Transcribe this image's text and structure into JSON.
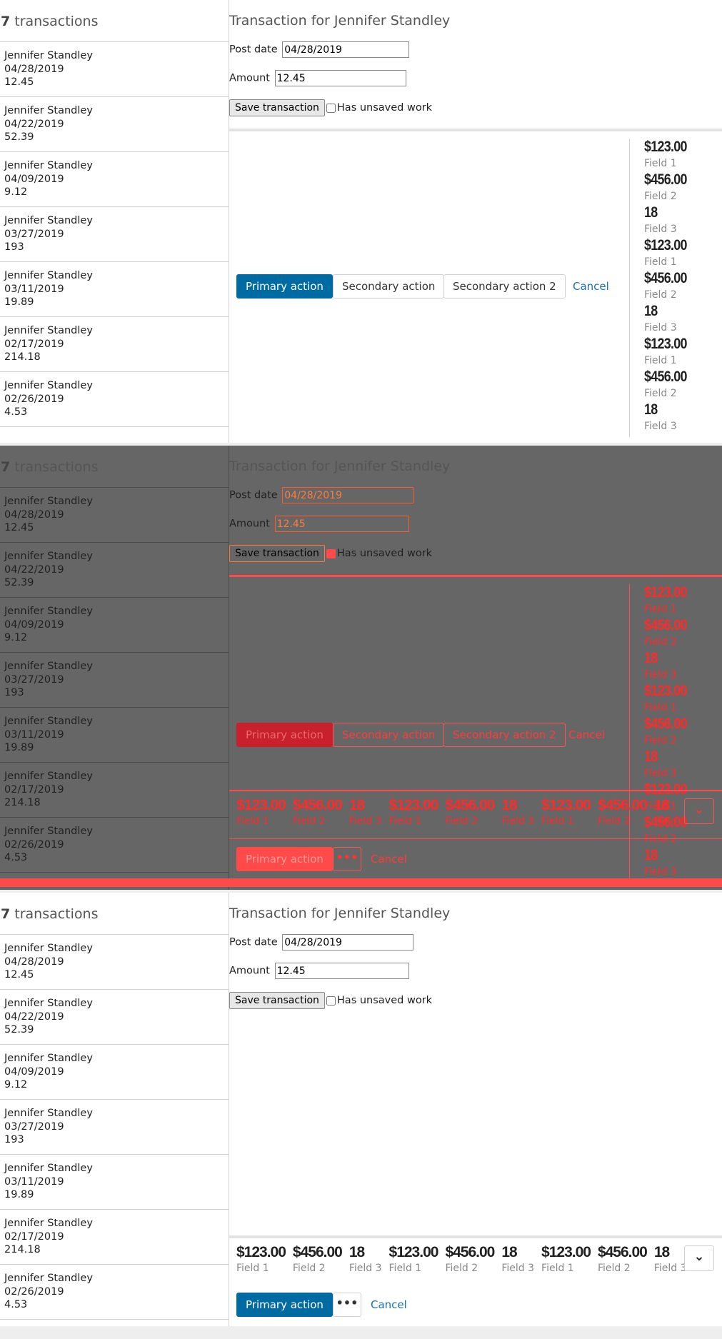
{
  "list": {
    "count": "7",
    "count_suffix": " transactions",
    "items": [
      {
        "name": "Jennifer Standley",
        "date": "04/28/2019",
        "amount": "12.45"
      },
      {
        "name": "Jennifer Standley",
        "date": "04/22/2019",
        "amount": "52.39"
      },
      {
        "name": "Jennifer Standley",
        "date": "04/09/2019",
        "amount": "9.12"
      },
      {
        "name": "Jennifer Standley",
        "date": "03/27/2019",
        "amount": "193"
      },
      {
        "name": "Jennifer Standley",
        "date": "03/11/2019",
        "amount": "19.89"
      },
      {
        "name": "Jennifer Standley",
        "date": "02/17/2019",
        "amount": "214.18"
      },
      {
        "name": "Jennifer Standley",
        "date": "02/26/2019",
        "amount": "4.53"
      }
    ]
  },
  "form": {
    "title": "Transaction for Jennifer Standley",
    "post_date_label": "Post date",
    "post_date_value": "04/28/2019",
    "amount_label": "Amount",
    "amount_value": "12.45",
    "save_label": "Save transaction",
    "unsaved_label": "Has unsaved work"
  },
  "actions": {
    "primary": "Primary action",
    "secondary": "Secondary action",
    "secondary2": "Secondary action 2",
    "cancel": "Cancel",
    "more": "•••"
  },
  "summary": {
    "field1_value": "$123.00",
    "field1_label": "Field 1",
    "field2_value": "$456.00",
    "field2_label": "Field 2",
    "field3_value": "18",
    "field3_label": "Field 3"
  },
  "colors": {
    "primary": "#006aa3",
    "link": "#1870b8",
    "debug_outline": "#ff4a4a",
    "overlay_bg": "#666666"
  },
  "icons": {
    "expand": "chevron-down-icon"
  }
}
